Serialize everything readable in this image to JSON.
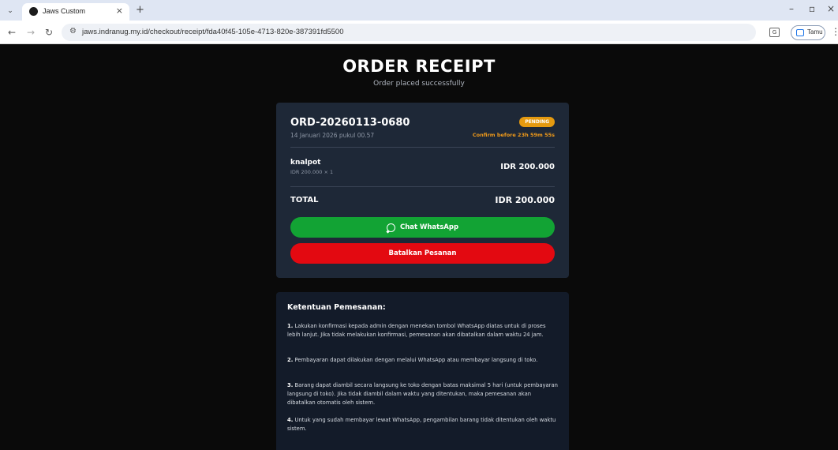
{
  "browser": {
    "tab_title": "Jaws Custom",
    "url": "jaws.indranug.my.id/checkout/receipt/fda40f45-105e-4713-820e-387391fd5500",
    "profile_label": "Tamu"
  },
  "header": {
    "title": "ORDER RECEIPT",
    "subtitle": "Order placed successfully"
  },
  "order": {
    "id": "ORD-20260113-0680",
    "date": "14 Januari 2026 pukul 00.57",
    "status": "PENDING",
    "confirm_text": "Confirm before 23h 59m 55s",
    "items": [
      {
        "name": "knalpot",
        "qty_price": "IDR 200.000 × 1",
        "subtotal": "IDR 200.000"
      }
    ],
    "total_label": "TOTAL",
    "total_value": "IDR 200.000"
  },
  "actions": {
    "whatsapp_label": "Chat WhatsApp",
    "cancel_label": "Batalkan Pesanan"
  },
  "terms": {
    "title": "Ketentuan Pemesanan:",
    "items": [
      {
        "num": "1.",
        "text": "Lakukan konfirmasi kepada admin dengan menekan tombol WhatsApp diatas untuk di proses lebih lanjut. Jika tidak melakukan konfirmasi, pemesanan akan dibatalkan dalam waktu 24 jam."
      },
      {
        "num": "2.",
        "text": "Pembayaran dapat dilakukan dengan melalui WhatsApp atau membayar langsung di toko."
      },
      {
        "num": "3.",
        "text": "Barang dapat diambil secara langsung ke toko dengan batas maksimal 5 hari (untuk pembayaran langsung di toko). Jika tidak diambil dalam waktu yang ditentukan, maka pemesanan akan dibatalkan otomatis oleh sistem."
      },
      {
        "num": "4.",
        "text": "Untuk yang sudah membayar lewat WhatsApp, pengambilan barang tidak ditentukan oleh waktu sistem."
      }
    ]
  },
  "colors": {
    "page_bg": "#0a0a0a",
    "card_bg": "#1e2837",
    "terms_bg": "#131b29",
    "pending": "#e59a10",
    "whatsapp": "#12a334",
    "cancel": "#e30911"
  },
  "icons": {
    "whatsapp": "whatsapp-icon",
    "site_info": "site-info-icon"
  }
}
